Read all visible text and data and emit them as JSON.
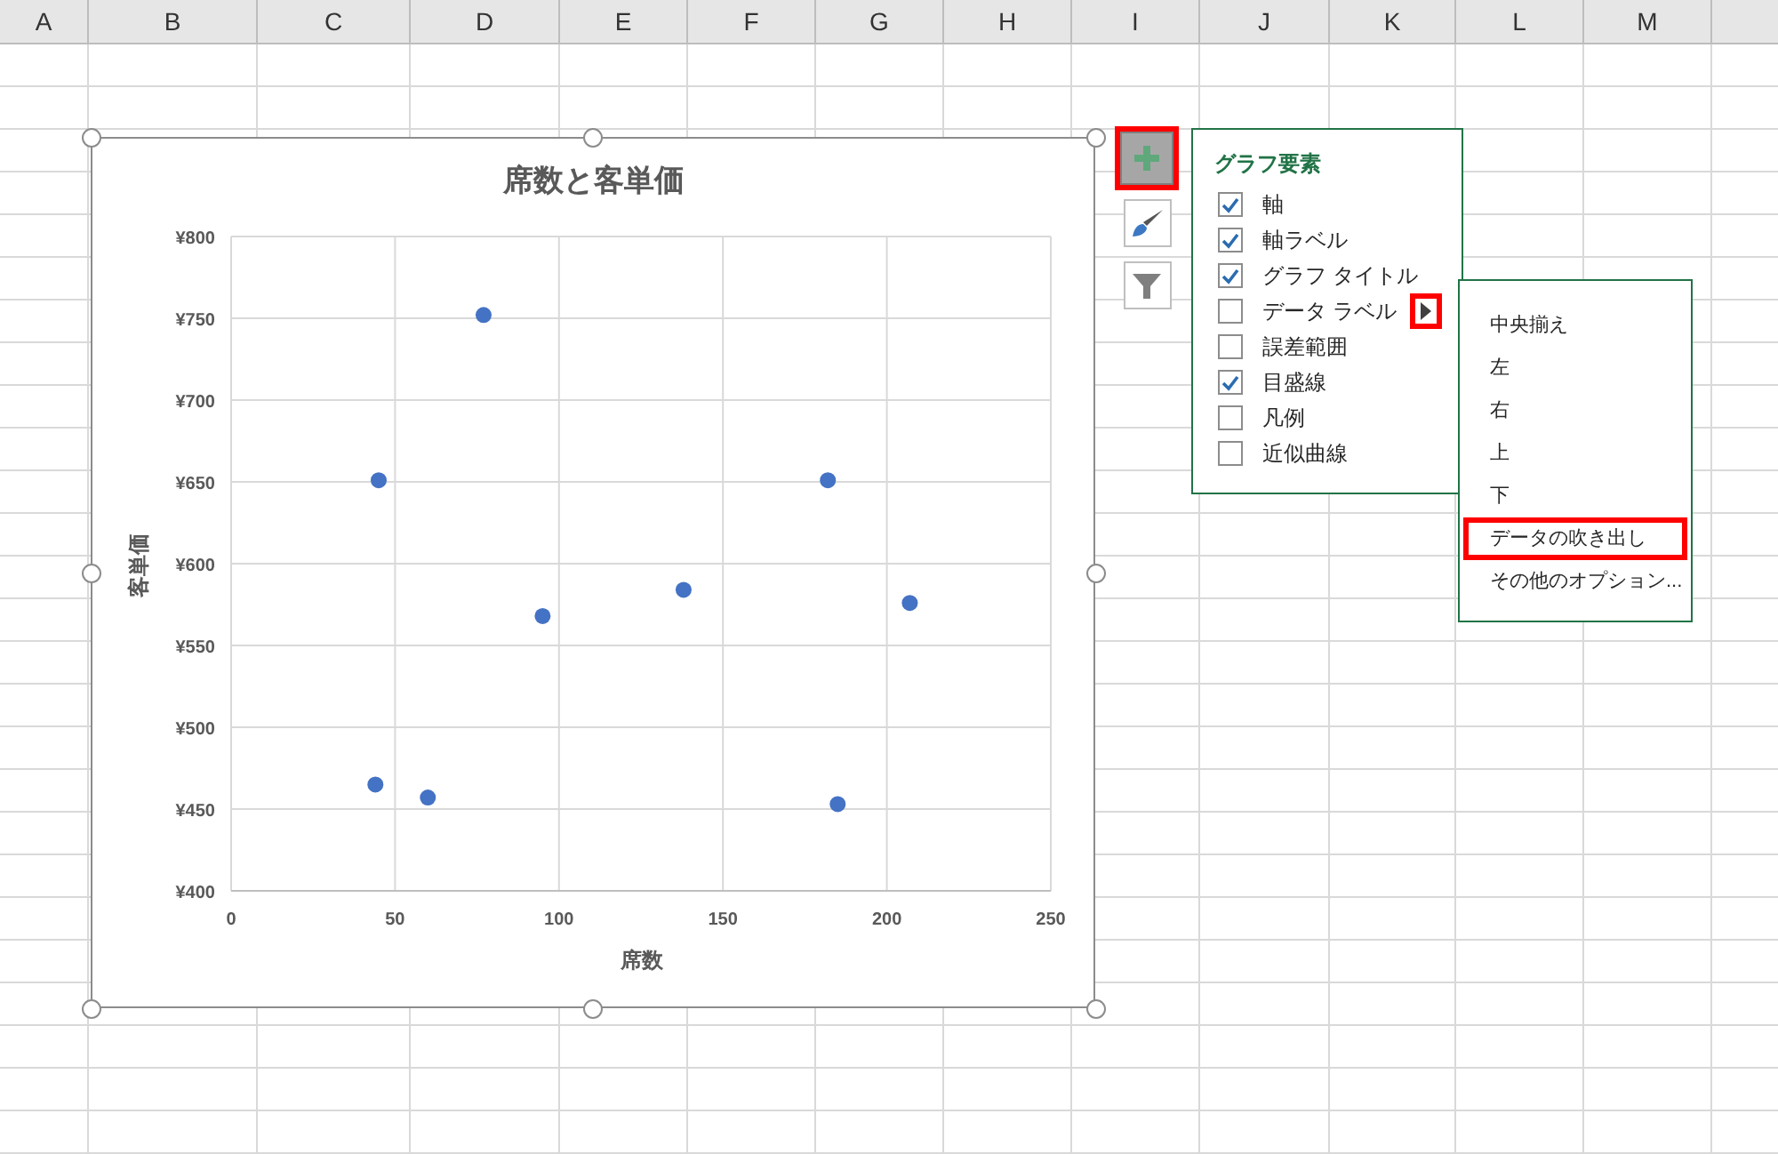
{
  "sheet": {
    "columns": [
      "A",
      "B",
      "C",
      "D",
      "E",
      "F",
      "G",
      "H",
      "I",
      "J",
      "K",
      "L",
      "M"
    ]
  },
  "chart": {
    "selected": true,
    "chart_data": {
      "type": "scatter",
      "title": "席数と客単価",
      "xlabel": "席数",
      "ylabel": "客単価",
      "x": [
        77,
        45,
        182,
        95,
        138,
        207,
        44,
        60,
        185
      ],
      "series": [
        {
          "color": "#4472c4",
          "values": [
            752,
            651,
            651,
            568,
            584,
            576,
            465,
            457,
            453
          ]
        }
      ],
      "grid": true,
      "xlim": [
        0,
        250
      ],
      "ylim": [
        400,
        800
      ],
      "xticks": [
        0,
        50,
        100,
        150,
        200,
        250
      ],
      "yticks": [
        {
          "value": 400,
          "label": "¥400"
        },
        {
          "value": 450,
          "label": "¥450"
        },
        {
          "value": 500,
          "label": "¥500"
        },
        {
          "value": 550,
          "label": "¥550"
        },
        {
          "value": 600,
          "label": "¥600"
        },
        {
          "value": 650,
          "label": "¥650"
        },
        {
          "value": 700,
          "label": "¥700"
        },
        {
          "value": 750,
          "label": "¥750"
        },
        {
          "value": 800,
          "label": "¥800"
        }
      ]
    }
  },
  "chart_tools": [
    {
      "kind": "elements",
      "selected": true,
      "highlighted": true
    },
    {
      "kind": "styles",
      "selected": false,
      "highlighted": false
    },
    {
      "kind": "filter",
      "selected": false,
      "highlighted": false
    }
  ],
  "elements_panel": {
    "title": "グラフ要素",
    "items": [
      {
        "label": "軸",
        "checked": true,
        "expanded": false
      },
      {
        "label": "軸ラベル",
        "checked": true,
        "expanded": false
      },
      {
        "label": "グラフ タイトル",
        "checked": true,
        "expanded": false
      },
      {
        "label": "データ ラベル",
        "checked": false,
        "expanded": true
      },
      {
        "label": "誤差範囲",
        "checked": false,
        "expanded": false
      },
      {
        "label": "目盛線",
        "checked": true,
        "expanded": false
      },
      {
        "label": "凡例",
        "checked": false,
        "expanded": false
      },
      {
        "label": "近似曲線",
        "checked": false,
        "expanded": false
      }
    ]
  },
  "submenu": {
    "items": [
      {
        "label": "中央揃え",
        "highlighted": false
      },
      {
        "label": "左",
        "highlighted": false
      },
      {
        "label": "右",
        "highlighted": false
      },
      {
        "label": "上",
        "highlighted": false
      },
      {
        "label": "下",
        "highlighted": false
      },
      {
        "label": "データの吹き出し",
        "highlighted": true
      },
      {
        "label": "その他のオプション...",
        "highlighted": false
      }
    ]
  }
}
